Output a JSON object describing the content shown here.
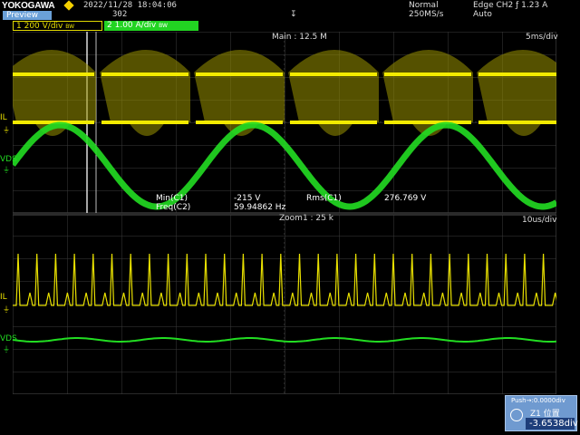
{
  "header": {
    "brand": "YOKOGAWA",
    "preview_label": "Preview",
    "datetime": "2022/11/28 18:04:06",
    "acq_count": "302",
    "trigger_position_mark": "↧",
    "acq_mode": "Normal",
    "sample_rate": "250MS/s",
    "trigger_info": "Edge CH2 ƒ 1.23 A",
    "trigger_mode": "Auto"
  },
  "channels": {
    "ch1": {
      "index": "1",
      "scale": "200 V/div",
      "bandwidth": "BW",
      "color": "#e8e000"
    },
    "ch2": {
      "index": "2",
      "scale": "1.00 A/div",
      "bandwidth": "BW",
      "color": "#22dd22"
    }
  },
  "main_window": {
    "title": "Main : 12.5 M",
    "timebase": "5ms/div",
    "trace_labels": {
      "il": "IL",
      "vds": "VDS"
    }
  },
  "measurements": [
    {
      "name": "Min(C1)",
      "value": "-215 V"
    },
    {
      "name": "Freq(C2)",
      "value": "59.94862 Hz"
    },
    {
      "name": "Rms(C1)",
      "value": "276.769 V"
    }
  ],
  "zoom_window": {
    "title": "Zoom1 : 25 k",
    "timebase": "10us/div",
    "trace_labels": {
      "il": "IL",
      "vds": "VDS"
    }
  },
  "zoom_control": {
    "push_label": "Push→:0.0000div",
    "zoom_label": "Z1 位置",
    "position_value": "-3.6538div"
  },
  "colors": {
    "ch1": "#e8e000",
    "ch2": "#22dd22",
    "grid": "#3b3b3b",
    "accent": "#6aa0d8"
  }
}
